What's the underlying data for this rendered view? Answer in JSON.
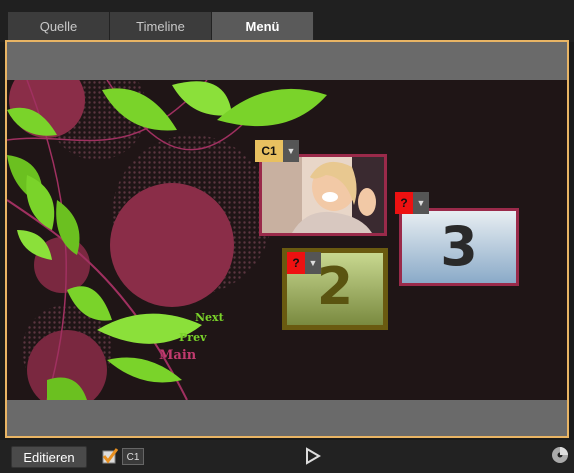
{
  "tabs": [
    {
      "label": "Quelle",
      "active": false
    },
    {
      "label": "Timeline",
      "active": false
    },
    {
      "label": "Menü",
      "active": true
    }
  ],
  "menu": {
    "nav_next": "Next",
    "nav_prev": "Prev",
    "nav_main": "Main",
    "buttons": [
      {
        "badge": "C1",
        "badge_color": "#e8c060",
        "content": "video-thumbnail"
      },
      {
        "badge": "?",
        "badge_color": "#ee1111",
        "number": "3"
      },
      {
        "badge": "?",
        "badge_color": "#ee1111",
        "number": "2"
      }
    ]
  },
  "bottom": {
    "edit_label": "Editieren",
    "checkbox_checked": true,
    "chapter_label": "C1",
    "play_icon": "play-icon",
    "disc_icon": "disc-icon"
  },
  "colors": {
    "frame_border": "#e8b464",
    "canvas_bg": "#1f1516",
    "accent_green": "#7ad32a",
    "accent_pink": "#c03a6e"
  }
}
